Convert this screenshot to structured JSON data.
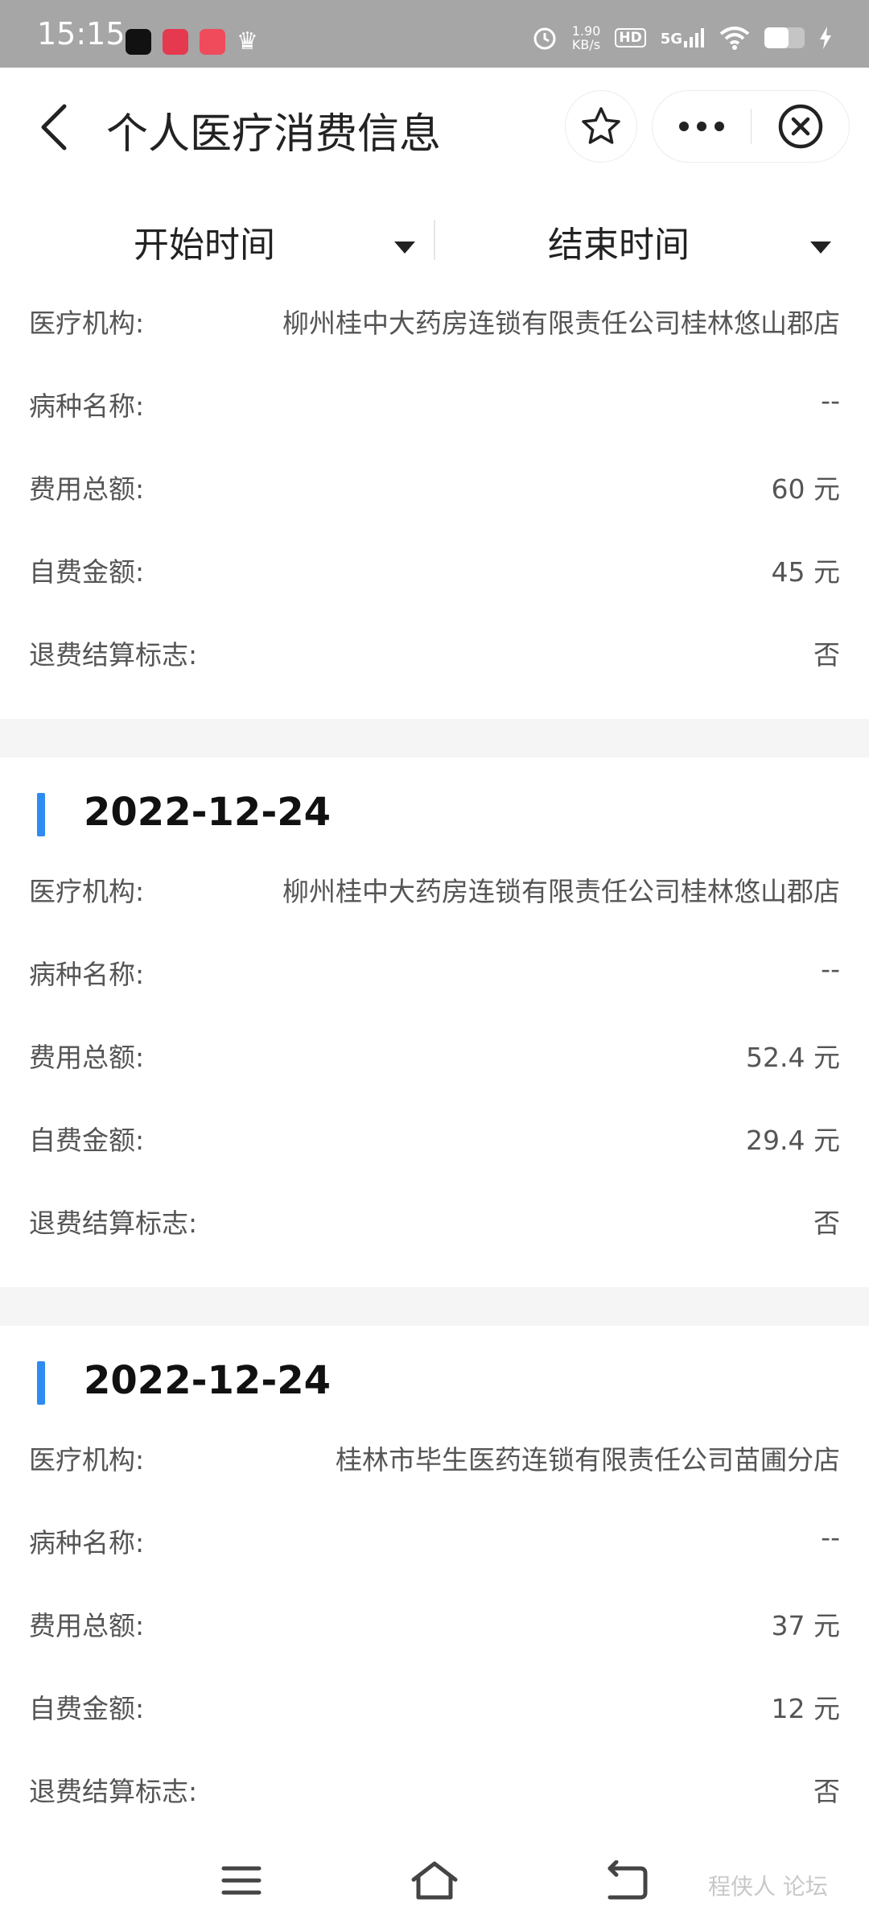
{
  "status_bar": {
    "time": "15:15",
    "speed_top": "1.90",
    "speed_bottom": "KB/s",
    "hd": "HD",
    "network": "5G",
    "battery_level": 0.6
  },
  "header": {
    "title": "个人医疗消费信息"
  },
  "filter": {
    "start_label": "开始时间",
    "end_label": "结束时间"
  },
  "labels": {
    "institution": "医疗机构:",
    "disease": "病种名称:",
    "total": "费用总额:",
    "self_pay": "自费金额:",
    "refund": "退费结算标志:"
  },
  "records": [
    {
      "date": "",
      "institution": "柳州桂中大药房连锁有限责任公司桂林悠山郡店",
      "disease": "--",
      "total": "60 元",
      "self_pay": "45 元",
      "refund": "否"
    },
    {
      "date": "2022-12-24",
      "institution": "柳州桂中大药房连锁有限责任公司桂林悠山郡店",
      "disease": "--",
      "total": "52.4 元",
      "self_pay": "29.4 元",
      "refund": "否"
    },
    {
      "date": "2022-12-24",
      "institution": "桂林市毕生医药连锁有限责任公司苗圃分店",
      "disease": "--",
      "total": "37 元",
      "self_pay": "12 元",
      "refund": "否"
    }
  ],
  "watermark": "程侠人 论坛",
  "colors": {
    "accent": "#2e8cf0",
    "status_bar": "#a6a6a6"
  }
}
